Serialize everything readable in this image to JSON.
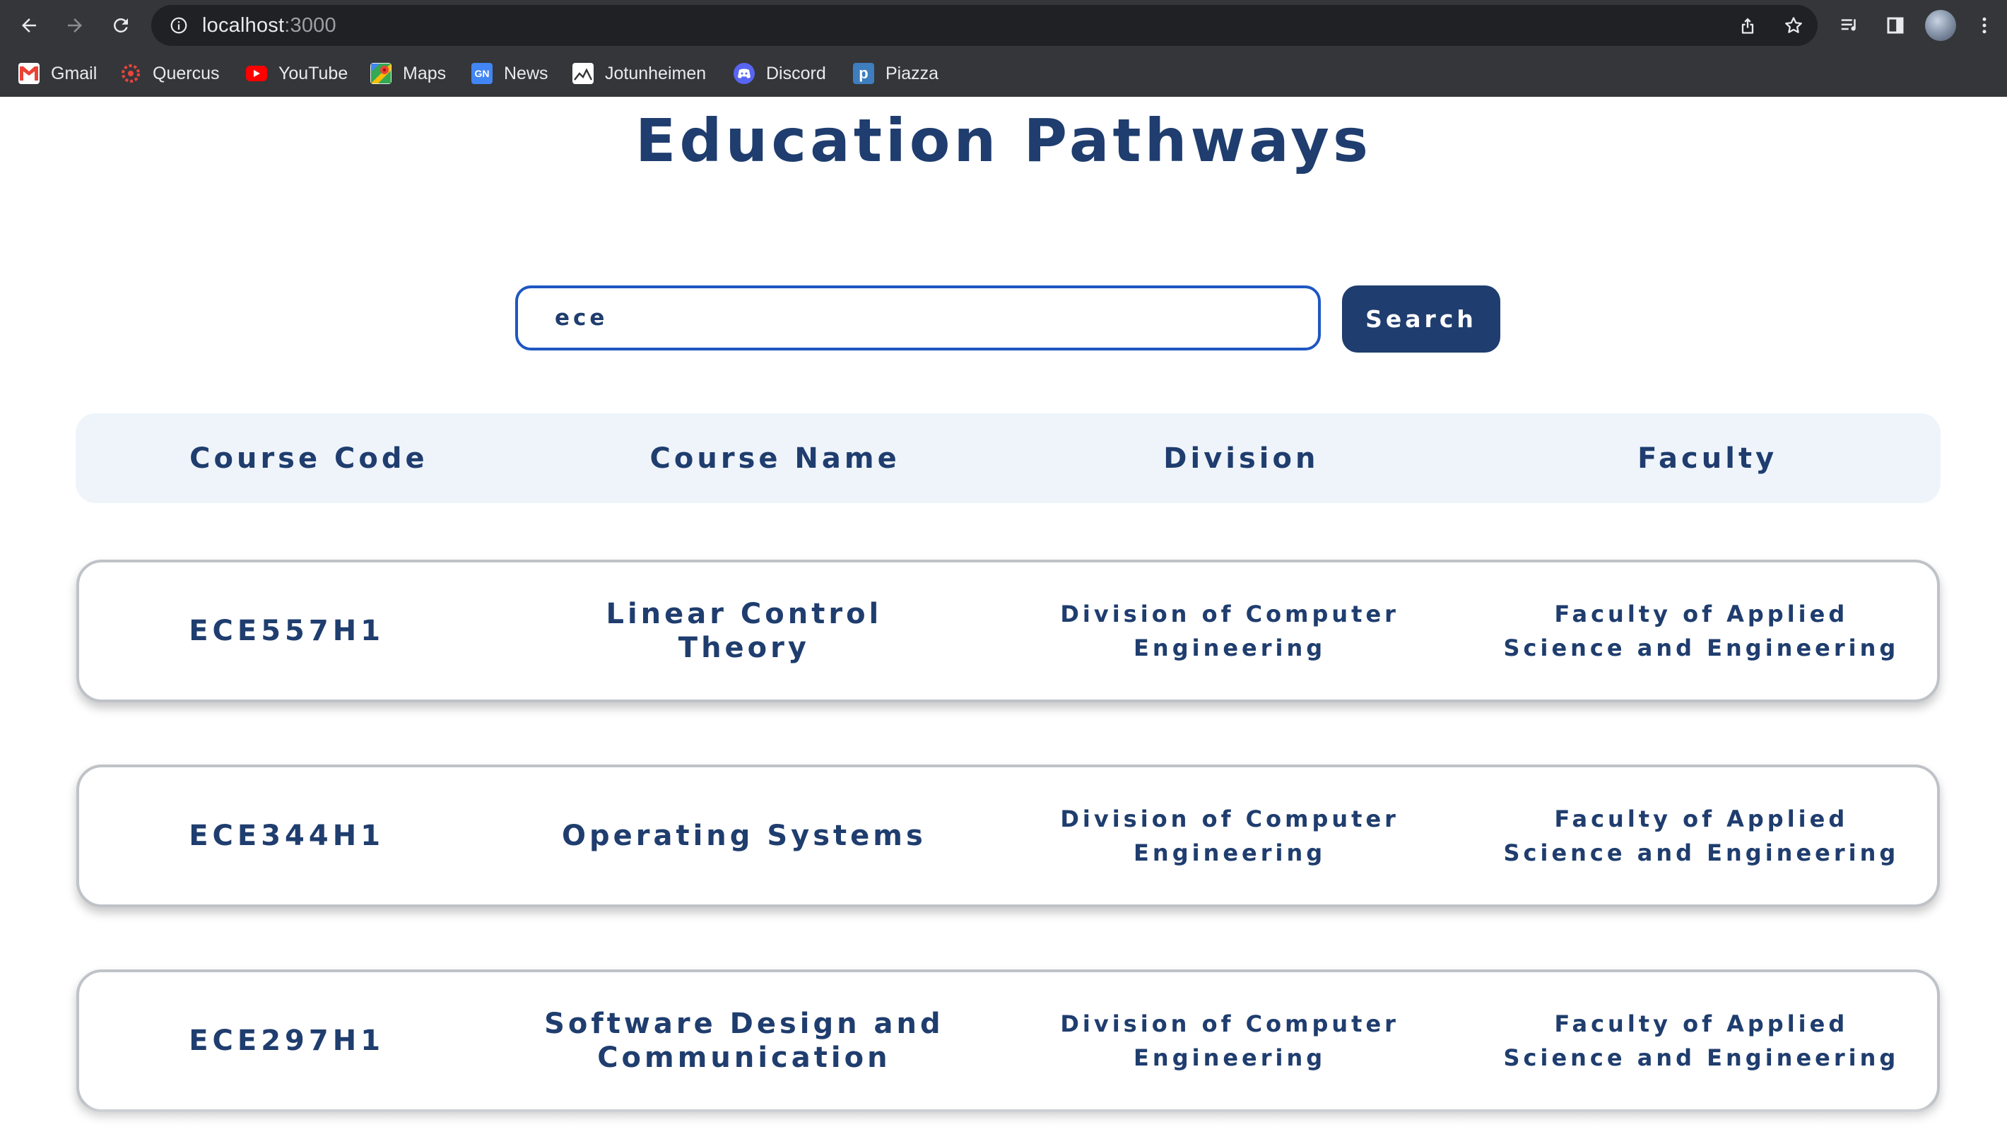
{
  "browser": {
    "url_host": "localhost",
    "url_port": ":3000",
    "icons": [
      "back-icon",
      "forward-icon",
      "reload-icon",
      "info-icon",
      "share-icon",
      "star-icon",
      "reading-list-icon",
      "side-panel-icon",
      "profile-avatar",
      "menu-icon"
    ],
    "bookmarks": [
      {
        "label": "Gmail",
        "icon": "gmail-icon",
        "color": "#ea4335"
      },
      {
        "label": "Quercus",
        "icon": "quercus-icon",
        "color": "#e8453c"
      },
      {
        "label": "YouTube",
        "icon": "youtube-icon",
        "color": "#ff0000"
      },
      {
        "label": "Maps",
        "icon": "maps-icon",
        "color": "#34a853"
      },
      {
        "label": "News",
        "icon": "news-icon",
        "color": "#4285f4"
      },
      {
        "label": "Jotunheimen",
        "icon": "jotunheimen-icon",
        "color": "#ffffff"
      },
      {
        "label": "Discord",
        "icon": "discord-icon",
        "color": "#5865f2"
      },
      {
        "label": "Piazza",
        "icon": "piazza-icon",
        "color": "#3e7ebf"
      }
    ]
  },
  "page": {
    "title": "Education Pathways",
    "accent_color": "#1f3d6e",
    "search": {
      "value": "ece",
      "button_label": "Search"
    },
    "columns": [
      "Course Code",
      "Course Name",
      "Division",
      "Faculty"
    ],
    "rows": [
      {
        "code": "ECE557H1",
        "name": "Linear Control Theory",
        "division": "Division of Computer Engineering",
        "faculty": "Faculty of Applied Science and Engineering"
      },
      {
        "code": "ECE344H1",
        "name": "Operating Systems",
        "division": "Division of Computer Engineering",
        "faculty": "Faculty of Applied Science and Engineering"
      },
      {
        "code": "ECE297H1",
        "name": "Software Design and Communication",
        "division": "Division of Computer Engineering",
        "faculty": "Faculty of Applied Science and Engineering"
      }
    ]
  }
}
